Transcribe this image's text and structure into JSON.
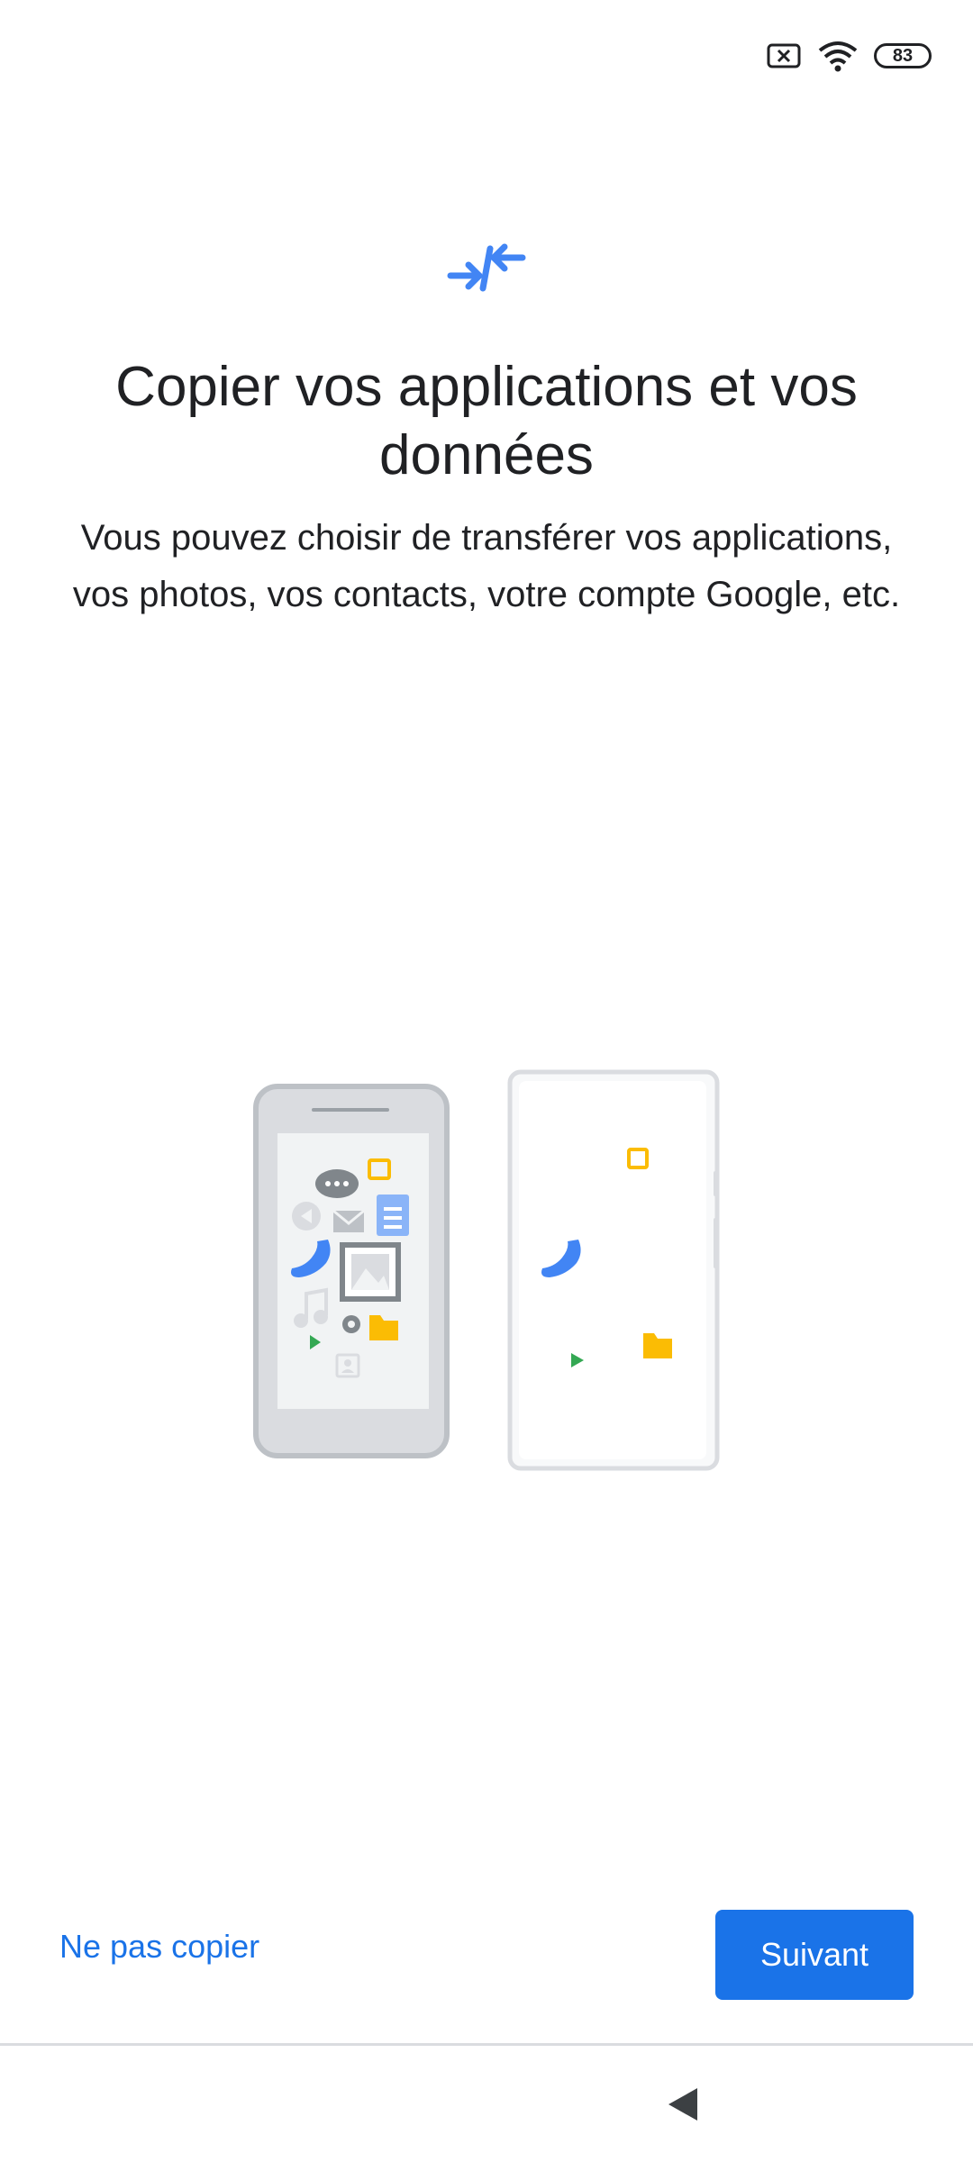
{
  "status_bar": {
    "battery_level": "83",
    "icons": [
      "no-sim-icon",
      "wifi-icon",
      "battery-icon"
    ]
  },
  "hero": {
    "icon": "transfer-arrows-icon",
    "accent_color": "#4285f4"
  },
  "content": {
    "title": "Copier vos applications et vos données",
    "subtitle": "Vous pouvez choisir de transférer vos applications, vos photos, vos contacts, votre compte Google, etc."
  },
  "illustration": {
    "old_phone_icons": [
      "chat-icon",
      "calendar-icon",
      "document-icon",
      "back-icon",
      "mail-icon",
      "phone-icon",
      "image-icon",
      "music-icon",
      "settings-icon",
      "folder-icon",
      "play-icon",
      "contact-icon"
    ],
    "new_phone_icons": [
      "calendar-icon",
      "phone-icon",
      "play-icon",
      "folder-icon"
    ]
  },
  "actions": {
    "skip_label": "Ne pas copier",
    "next_label": "Suivant"
  },
  "colors": {
    "primary": "#1a73e8",
    "text": "#202124",
    "yellow": "#fbbc04",
    "green": "#34a853",
    "grey": "#9aa0a6"
  },
  "nav_bar": {
    "back_icon": "back-triangle-icon"
  }
}
